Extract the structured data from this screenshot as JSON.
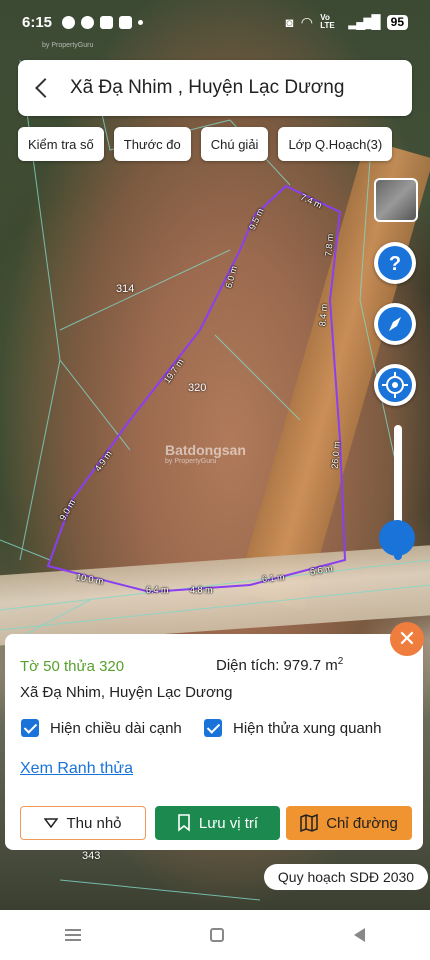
{
  "status": {
    "time": "6:15",
    "lte": "Vo LTE",
    "battery": "95"
  },
  "header": {
    "title": "Xã Đạ Nhim , Huyện Lạc Dương"
  },
  "tools": [
    "Kiểm tra số",
    "Thước đo",
    "Chú giải",
    "Lớp Q.Hoạch(3)"
  ],
  "map": {
    "parcel_labels": [
      "314",
      "320",
      "343"
    ],
    "edge_lengths": [
      "7.4 m",
      "7.8 m",
      "8.4 m",
      "26.0 m",
      "5.6 m",
      "6.1 m",
      "4.8 m",
      "6.4 m",
      "10.0 m",
      "9.0 m",
      "4.9 m",
      "19.7 m",
      "6.0 m",
      "9.5 m"
    ],
    "watermark": "Batdongsan",
    "watermark_sub": "by PropertyGuru",
    "top_watermark": "by PropertyGuru",
    "boundary_color": "#7b3fe0"
  },
  "controls": {
    "help_icon": "question-icon",
    "compass_icon": "compass-icon",
    "locate_icon": "locate-icon"
  },
  "panel": {
    "plot_id": "Tờ 50 thửa 320",
    "area_label": "Diện tích: 979.7 m",
    "area_unit_sup": "2",
    "address": "Xã Đạ Nhim, Huyện Lạc Dương",
    "check_edges": "Hiện chiều dài cạnh",
    "check_neighbors": "Hiện thửa xung quanh",
    "link": "Xem Ranh thửa",
    "btn_shrink": "Thu nhỏ",
    "btn_save": "Lưu vị trí",
    "btn_directions": "Chỉ đường"
  },
  "planning_badge": "Quy hoạch SDĐ 2030",
  "colors": {
    "accent": "#1a73d9",
    "green": "#1c8a4f",
    "orange": "#ef9430",
    "plot_green": "#58a02d"
  }
}
